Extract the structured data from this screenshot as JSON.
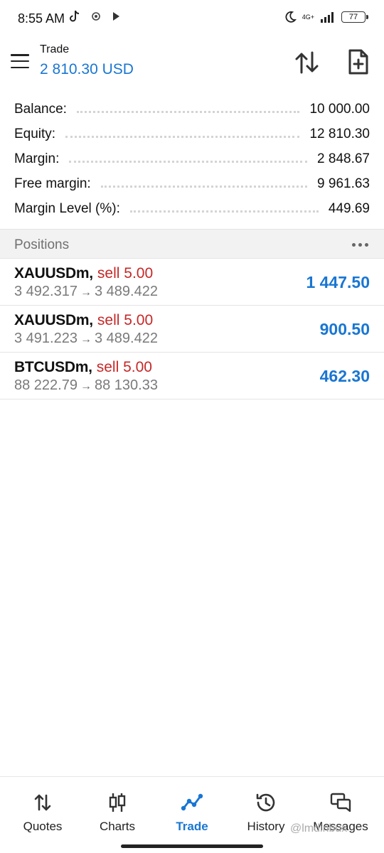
{
  "status_bar": {
    "time": "8:55 AM",
    "network": "4G+",
    "battery": "77"
  },
  "header": {
    "title": "Trade",
    "balance_display": "2 810.30 USD"
  },
  "summary": [
    {
      "label": "Balance:",
      "value": "10 000.00"
    },
    {
      "label": "Equity:",
      "value": "12 810.30"
    },
    {
      "label": "Margin:",
      "value": "2 848.67"
    },
    {
      "label": "Free margin:",
      "value": "9 961.63"
    },
    {
      "label": "Margin Level (%):",
      "value": "449.69"
    }
  ],
  "positions": {
    "title": "Positions",
    "items": [
      {
        "symbol": "XAUUSDm",
        "side_volume": "sell 5.00",
        "open_price": "3 492.317",
        "current_price": "3 489.422",
        "profit": "1 447.50"
      },
      {
        "symbol": "XAUUSDm",
        "side_volume": "sell 5.00",
        "open_price": "3 491.223",
        "current_price": "3 489.422",
        "profit": "900.50"
      },
      {
        "symbol": "BTCUSDm",
        "side_volume": "sell 5.00",
        "open_price": "88 222.79",
        "current_price": "88 130.33",
        "profit": "462.30"
      }
    ]
  },
  "bottom_nav": {
    "items": [
      {
        "label": "Quotes",
        "icon": "quotes-arrows-icon"
      },
      {
        "label": "Charts",
        "icon": "candlestick-icon"
      },
      {
        "label": "Trade",
        "icon": "trade-line-icon",
        "active": true
      },
      {
        "label": "History",
        "icon": "history-clock-icon"
      },
      {
        "label": "Messages",
        "icon": "messages-icon"
      }
    ]
  },
  "watermark": "@lmdinbux",
  "colors": {
    "accent": "#1976d2",
    "sell": "#c62828",
    "muted": "#7a7a7a"
  }
}
